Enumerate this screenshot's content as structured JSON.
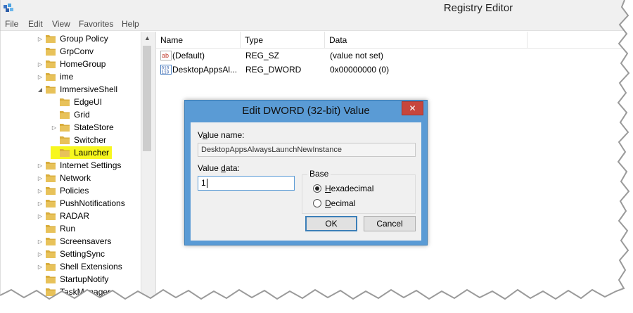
{
  "window": {
    "title": "Registry Editor"
  },
  "menu": [
    "File",
    "Edit",
    "View",
    "Favorites",
    "Help"
  ],
  "tree": [
    {
      "label": "Group Policy",
      "level": 1,
      "expander": "collapsed"
    },
    {
      "label": "GrpConv",
      "level": 1,
      "expander": "none"
    },
    {
      "label": "HomeGroup",
      "level": 1,
      "expander": "collapsed"
    },
    {
      "label": "ime",
      "level": 1,
      "expander": "collapsed"
    },
    {
      "label": "ImmersiveShell",
      "level": 1,
      "expander": "expanded"
    },
    {
      "label": "EdgeUI",
      "level": 2,
      "expander": "none"
    },
    {
      "label": "Grid",
      "level": 2,
      "expander": "none"
    },
    {
      "label": "StateStore",
      "level": 2,
      "expander": "collapsed"
    },
    {
      "label": "Switcher",
      "level": 2,
      "expander": "none"
    },
    {
      "label": "Launcher",
      "level": 2,
      "expander": "none",
      "highlighted": true
    },
    {
      "label": "Internet Settings",
      "level": 1,
      "expander": "collapsed"
    },
    {
      "label": "Network",
      "level": 1,
      "expander": "collapsed"
    },
    {
      "label": "Policies",
      "level": 1,
      "expander": "collapsed"
    },
    {
      "label": "PushNotifications",
      "level": 1,
      "expander": "collapsed"
    },
    {
      "label": "RADAR",
      "level": 1,
      "expander": "collapsed"
    },
    {
      "label": "Run",
      "level": 1,
      "expander": "none"
    },
    {
      "label": "Screensavers",
      "level": 1,
      "expander": "collapsed"
    },
    {
      "label": "SettingSync",
      "level": 1,
      "expander": "collapsed"
    },
    {
      "label": "Shell Extensions",
      "level": 1,
      "expander": "collapsed"
    },
    {
      "label": "StartupNotify",
      "level": 1,
      "expander": "none"
    },
    {
      "label": "TaskManager",
      "level": 1,
      "expander": "none"
    }
  ],
  "list": {
    "columns": [
      "Name",
      "Type",
      "Data"
    ],
    "rows": [
      {
        "icon": "string-value-icon",
        "name": "(Default)",
        "type": "REG_SZ",
        "data": "(value not set)"
      },
      {
        "icon": "binary-value-icon",
        "name": "DesktopAppsAl...",
        "type": "REG_DWORD",
        "data": "0x00000000 (0)"
      }
    ]
  },
  "dialog": {
    "title": "Edit DWORD (32-bit) Value",
    "close_label": "✕",
    "value_name_label": "Value name:",
    "value_name": "DesktopAppsAlwaysLaunchNewInstance",
    "value_data_label": "Value data:",
    "value_data": "1",
    "base_label": "Base",
    "base_options": [
      {
        "label": "Hexadecimal",
        "checked": true
      },
      {
        "label": "Decimal",
        "checked": false
      }
    ],
    "ok_label": "OK",
    "cancel_label": "Cancel"
  },
  "colors": {
    "highlight": "#f7f71f",
    "dialog_frame": "#5a9bd5",
    "close_button": "#c7463d",
    "folder": "#e8c25a"
  }
}
